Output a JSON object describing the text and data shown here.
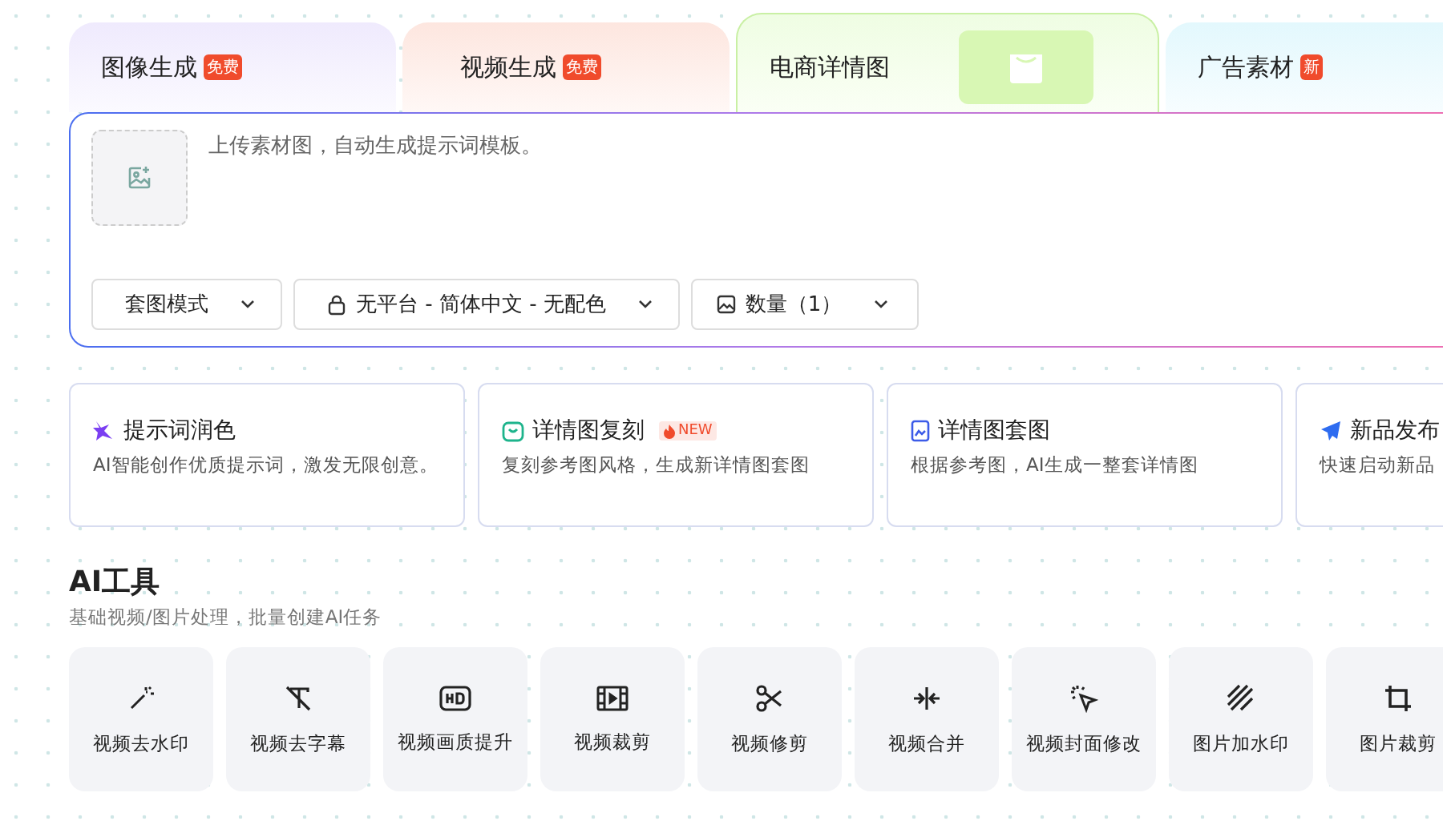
{
  "tabs": [
    {
      "label": "图像生成",
      "badge": "免费",
      "selected": false
    },
    {
      "label": "视频生成",
      "badge": "免费",
      "selected": false
    },
    {
      "label": "电商详情图",
      "selected": true
    },
    {
      "label": "广告素材",
      "badge": "新",
      "selected": false
    }
  ],
  "prompt": {
    "placeholder": "上传素材图，自动生成提示词模板。"
  },
  "selects": [
    {
      "label": "套图模式"
    },
    {
      "label": "无平台 - 简体中文 - 无配色"
    },
    {
      "label": "数量（1）"
    }
  ],
  "cards": [
    {
      "title": "提示词润色",
      "desc": "AI智能创作优质提示词，激发无限创意。"
    },
    {
      "title": "详情图复刻",
      "desc": "复刻参考图风格，生成新详情图套图",
      "badge": "NEW"
    },
    {
      "title": "详情图套图",
      "desc": "根据参考图，AI生成一整套详情图"
    },
    {
      "title": "新品发布",
      "desc": "快速启动新品"
    }
  ],
  "tools_section": {
    "title": "AI工具",
    "subtitle": "基础视频/图片处理，批量创建AI任务"
  },
  "tools": [
    {
      "label": "视频去水印"
    },
    {
      "label": "视频去字幕"
    },
    {
      "label": "视频画质提升"
    },
    {
      "label": "视频裁剪"
    },
    {
      "label": "视频修剪"
    },
    {
      "label": "视频合并"
    },
    {
      "label": "视频封面修改"
    },
    {
      "label": "图片加水印"
    },
    {
      "label": "图片裁剪"
    }
  ]
}
